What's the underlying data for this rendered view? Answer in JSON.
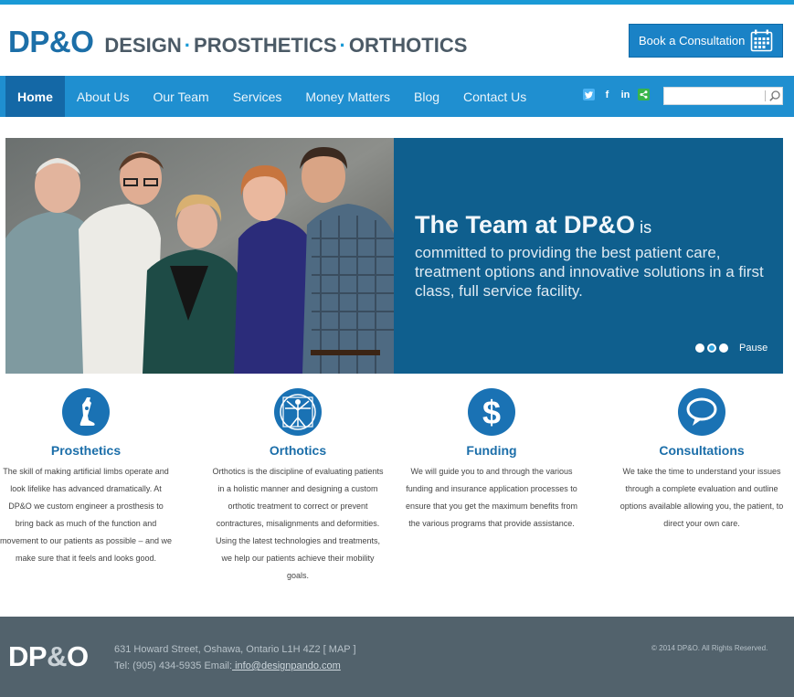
{
  "header": {
    "logo_mark_left": "DP",
    "logo_mark_amp": "&",
    "logo_mark_right": "O",
    "logo_word_1": "DESIGN",
    "logo_word_2": "PROSTHETICS",
    "logo_word_3": "ORTHOTICS",
    "logo_sep": "·",
    "book_button_label": "Book a Consultation"
  },
  "nav": {
    "items": [
      {
        "label": "Home",
        "active": true
      },
      {
        "label": "About Us"
      },
      {
        "label": "Our Team"
      },
      {
        "label": "Services"
      },
      {
        "label": "Money Matters"
      },
      {
        "label": "Blog"
      },
      {
        "label": "Contact Us"
      }
    ],
    "social": {
      "twitter": "twitter-icon",
      "facebook": "f",
      "linkedin": "in",
      "share": "share-icon"
    },
    "search_value": ""
  },
  "hero": {
    "title": "The Team at DP&O",
    "title_suffix": " is",
    "body": "committed to providing the best patient care, treatment options and innovative solutions in a first class, full service facility.",
    "pause_label": "Pause",
    "slide_count": 3,
    "active_slide": 2
  },
  "features": [
    {
      "icon": "prosthetic-leg-icon",
      "title": "Prosthetics",
      "body": "The skill of making artificial limbs operate and look lifelike has advanced dramatically. At DP&O we custom engineer a prosthesis to bring back as much of the function and movement to our patients as possible – and we make sure that it feels and looks good."
    },
    {
      "icon": "vitruvian-man-icon",
      "title": "Orthotics",
      "body": "Orthotics is the discipline of evaluating patients in a holistic manner and designing a custom orthotic treatment to correct or prevent contractures, misalignments and deformities. Using the latest technologies and treatments, we help our patients achieve their mobility goals."
    },
    {
      "icon": "dollar-icon",
      "title": "Funding",
      "body": "We will guide you to and through the various funding and insurance application processes to ensure that you get the maximum benefits from the various programs that provide assistance."
    },
    {
      "icon": "speech-bubble-icon",
      "title": "Consultations",
      "body": "We take the time to understand your issues through a complete evaluation and outline options available allowing you, the patient, to direct your own care."
    }
  ],
  "footer": {
    "logo_left": "DP",
    "logo_amp": "&",
    "logo_right": "O",
    "address": "631 Howard Street, Oshawa, Ontario L1H 4Z2 [ MAP ]",
    "tel": "Tel: (905) 434-5935 Email:",
    "email": " info@designpando.com",
    "copyright": "© 2014 DP&O. All Rights Reserved."
  },
  "colors": {
    "brand_blue": "#1c6fa8",
    "nav_blue": "#1f8fd0",
    "hero_blue": "#0f5f8e",
    "footer_gray": "#52626c"
  }
}
